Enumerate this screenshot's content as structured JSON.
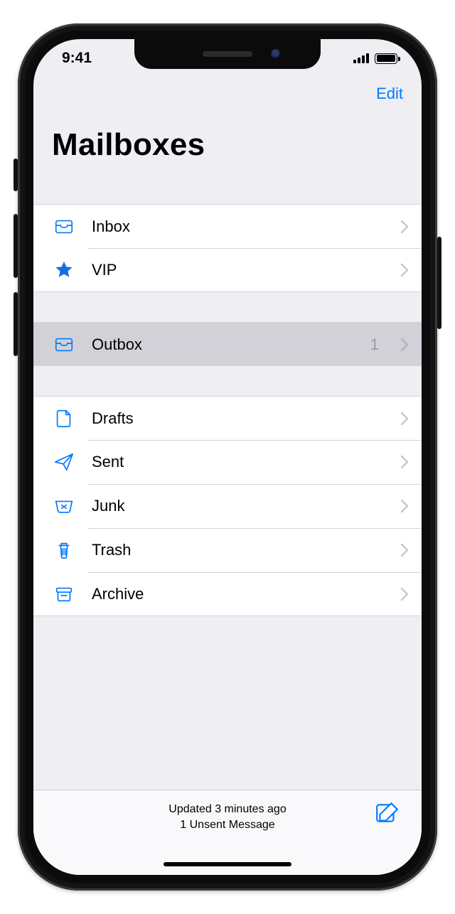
{
  "status": {
    "time": "9:41"
  },
  "nav": {
    "edit": "Edit",
    "title": "Mailboxes"
  },
  "groups": [
    {
      "rows": [
        {
          "id": "inbox",
          "icon": "tray",
          "label": "Inbox"
        },
        {
          "id": "vip",
          "icon": "star",
          "label": "VIP"
        }
      ]
    },
    {
      "rows": [
        {
          "id": "outbox",
          "icon": "tray",
          "label": "Outbox",
          "count": "1",
          "highlight": true
        }
      ]
    },
    {
      "rows": [
        {
          "id": "drafts",
          "icon": "doc",
          "label": "Drafts"
        },
        {
          "id": "sent",
          "icon": "paperplane",
          "label": "Sent"
        },
        {
          "id": "junk",
          "icon": "junk",
          "label": "Junk"
        },
        {
          "id": "trash",
          "icon": "trash",
          "label": "Trash"
        },
        {
          "id": "archive",
          "icon": "archivebox",
          "label": "Archive"
        }
      ]
    }
  ],
  "toolbar": {
    "line1": "Updated 3 minutes ago",
    "line2": "1 Unsent Message"
  }
}
